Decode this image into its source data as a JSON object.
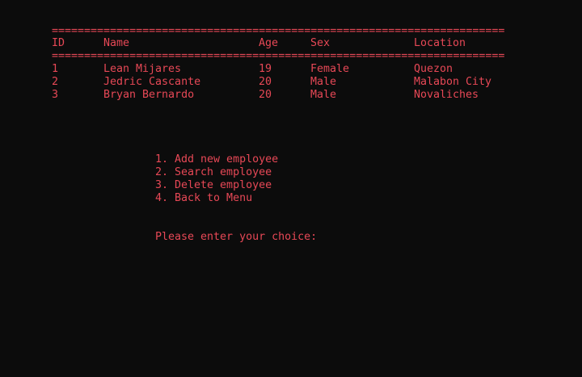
{
  "table": {
    "rule": "======================================================================",
    "headers": {
      "id": "ID",
      "name": "Name",
      "age": "Age",
      "sex": "Sex",
      "location": "Location"
    },
    "rows": [
      {
        "id": "1",
        "name": "Lean Mijares",
        "age": "19",
        "sex": "Female",
        "location": "Quezon"
      },
      {
        "id": "2",
        "name": "Jedric Cascante",
        "age": "20",
        "sex": "Male",
        "location": "Malabon City"
      },
      {
        "id": "3",
        "name": "Bryan Bernardo",
        "age": "20",
        "sex": "Male",
        "location": "Novaliches"
      }
    ]
  },
  "menu": {
    "items": [
      "1. Add new employee",
      "2. Search employee",
      "3. Delete employee",
      "4. Back to Menu"
    ],
    "prompt": "Please enter your choice:"
  },
  "colors": {
    "background": "#0c0c0c",
    "text": "#e74856"
  }
}
